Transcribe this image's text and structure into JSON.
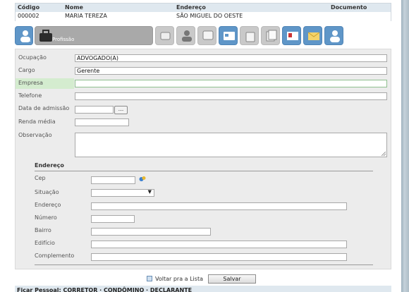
{
  "header": {
    "columns": [
      "Código",
      "Nome",
      "Endereço",
      "Documento"
    ],
    "row": {
      "codigo": "000002",
      "nome": "MARIA TEREZA",
      "endereco": "SÃO MIGUEL DO OESTE",
      "documento": ""
    }
  },
  "tabs": [
    {
      "name": "tab-dados-pessoais",
      "label": "",
      "state": "blue",
      "icon": "user-icon"
    },
    {
      "name": "tab-profissao",
      "label": "Profissão",
      "state": "active",
      "icon": "briefcase-icon"
    },
    {
      "name": "tab-3",
      "label": "",
      "state": "grey",
      "icon": "tags-icon"
    },
    {
      "name": "tab-4",
      "label": "",
      "state": "grey",
      "icon": "person-icon"
    },
    {
      "name": "tab-5",
      "label": "",
      "state": "grey",
      "icon": "note-icon"
    },
    {
      "name": "tab-6",
      "label": "",
      "state": "blue",
      "icon": "card-icon"
    },
    {
      "name": "tab-7",
      "label": "",
      "state": "grey",
      "icon": "bag-icon"
    },
    {
      "name": "tab-8",
      "label": "",
      "state": "grey",
      "icon": "documents-icon"
    },
    {
      "name": "tab-9",
      "label": "",
      "state": "blue",
      "icon": "contact-icon"
    },
    {
      "name": "tab-10",
      "label": "",
      "state": "blue",
      "icon": "envelope-icon"
    },
    {
      "name": "tab-11",
      "label": "",
      "state": "blue",
      "icon": "user-f-icon"
    }
  ],
  "form": {
    "ocupacao": {
      "label": "Ocupação",
      "value": "ADVOGADO(A)"
    },
    "cargo": {
      "label": "Cargo",
      "value": "Gerente"
    },
    "empresa": {
      "label": "Empresa",
      "value": ""
    },
    "telefone": {
      "label": "Telefone",
      "value": ""
    },
    "admissao": {
      "label": "Data de admissão",
      "value": "",
      "button": "..."
    },
    "renda": {
      "label": "Renda média",
      "value": ""
    },
    "observacao": {
      "label": "Observação",
      "value": ""
    }
  },
  "address": {
    "title": "Endereço",
    "cep": {
      "label": "Cep",
      "value": ""
    },
    "situacao": {
      "label": "Situação",
      "value": ""
    },
    "endereco": {
      "label": "Endereço",
      "value": ""
    },
    "numero": {
      "label": "Número",
      "value": ""
    },
    "bairro": {
      "label": "Bairro",
      "value": ""
    },
    "edificio": {
      "label": "Edifício",
      "value": ""
    },
    "complemento": {
      "label": "Complemento",
      "value": ""
    }
  },
  "actions": {
    "back_label": "Voltar pra a Lista",
    "save_label": "Salvar"
  },
  "footer_text": "Ficar Pessoal: CORRETOR · CONDÔMINO · DECLARANTE"
}
